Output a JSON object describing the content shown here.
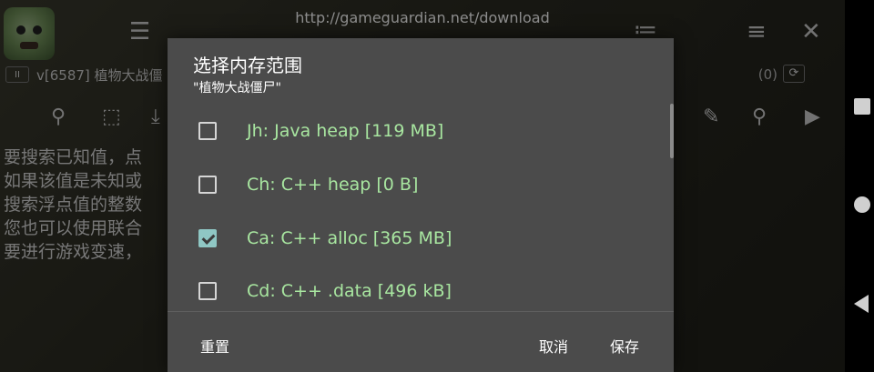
{
  "topbar": {
    "url": "http://gameguardian.net/download"
  },
  "process": {
    "pause_label": "II",
    "name": "v[6587] 植物大战僵",
    "count": "(0)",
    "refresh_icon": "refresh-icon"
  },
  "background_lines": [
    "要搜索已知值，点",
    "如果该值是未知或",
    "搜索浮点值的整数",
    "您也可以使用联合",
    "要进行游戏变速，"
  ],
  "dialog": {
    "title": "选择内存范围",
    "subtitle": "\"植物大战僵尸\"",
    "options": [
      {
        "label": "Jh: Java heap [119 MB]",
        "checked": false
      },
      {
        "label": "Ch: C++ heap [0 B]",
        "checked": false
      },
      {
        "label": "Ca: C++ alloc [365 MB]",
        "checked": true
      },
      {
        "label": "Cd: C++ .data [496 kB]",
        "checked": false
      }
    ],
    "reset_label": "重置",
    "cancel_label": "取消",
    "save_label": "保存"
  },
  "colors": {
    "dialog_bg": "#4b4b4b",
    "option_text": "#a8e6a0",
    "checkbox_checked": "#8fc7c4"
  }
}
